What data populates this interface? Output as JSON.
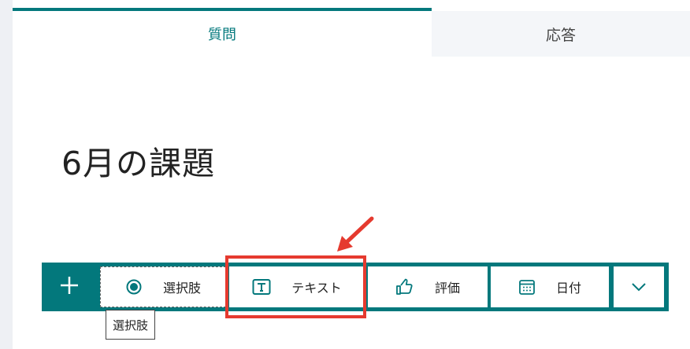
{
  "tabs": {
    "question_label": "質問",
    "response_label": "応答"
  },
  "form": {
    "title": "6月の課題"
  },
  "toolbar": {
    "add_icon": "plus-icon",
    "buttons": [
      {
        "label": "選択肢",
        "icon": "radio-icon"
      },
      {
        "label": "テキスト",
        "icon": "text-icon"
      },
      {
        "label": "評価",
        "icon": "thumbs-up-icon"
      },
      {
        "label": "日付",
        "icon": "calendar-icon"
      }
    ],
    "more_icon": "chevron-down-icon"
  },
  "tooltip": {
    "text": "選択肢"
  },
  "colors": {
    "accent": "#03787c",
    "highlight": "#e53a2f"
  }
}
